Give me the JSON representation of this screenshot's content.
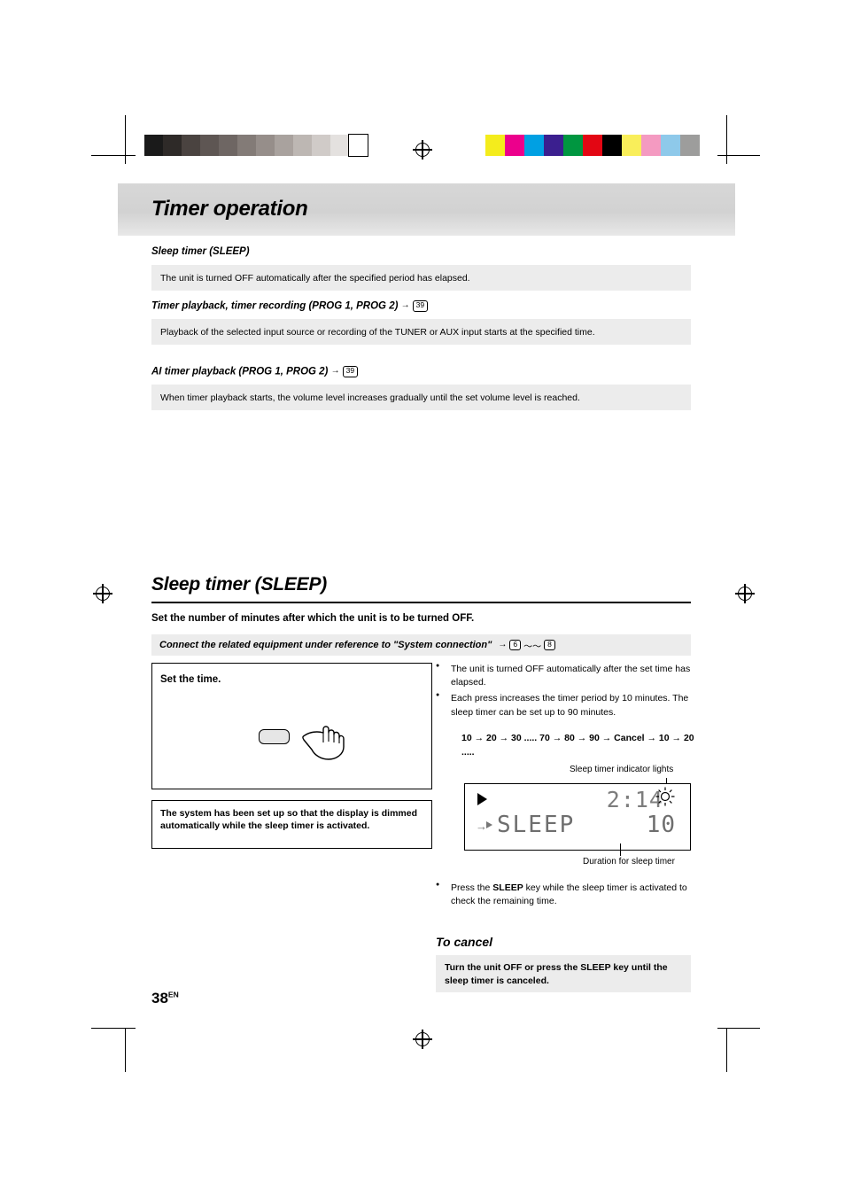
{
  "header": {
    "title": "Timer operation"
  },
  "sections": [
    {
      "heading": "Sleep timer (SLEEP)",
      "body": "The unit is turned OFF automatically after the specified period has elapsed.",
      "page_ref": null
    },
    {
      "heading": "Timer playback, timer recording (PROG 1, PROG 2)",
      "body": "Playback of the selected input source or recording of the TUNER or AUX input starts at the specified time.",
      "page_ref": "39"
    },
    {
      "heading": "AI timer playback (PROG 1, PROG 2)",
      "body": "When timer playback starts, the volume level increases gradually until the set volume level is reached.",
      "page_ref": "39"
    }
  ],
  "sleep_section": {
    "title": "Sleep timer (SLEEP)",
    "instruction": "Set the number of minutes after which the unit is to be turned OFF.",
    "connect_bar": {
      "text": "Connect the related equipment under reference to \"System connection\"",
      "ref_from": "6",
      "ref_to": "8",
      "ref_separator": "〜〜"
    },
    "set_box": {
      "label": "Set the time."
    },
    "dim_note": "The system has been set up so that the display is dimmed automatically while the sleep timer is activated.",
    "bullets": [
      "The unit is turned OFF automatically after the set time has elapsed.",
      "Each press increases the timer period by 10 minutes. The sleep timer can be set up to 90 minutes."
    ],
    "sequence": "10 → 20 → 30 ..... 70 → 80 → 90 → Cancel → 10 → 20 .....",
    "caption_top": "Sleep timer indicator lights",
    "caption_bottom": "Duration for sleep timer",
    "lcd": {
      "time": "2:14",
      "main_text": "SLEEP",
      "duration": "10"
    },
    "press_note_pre": "Press the ",
    "press_note_key": "SLEEP",
    "press_note_post": " key while the sleep timer is activated to check the remaining time.",
    "to_cancel_title": "To cancel",
    "cancel_text": "Turn the unit OFF or press the SLEEP key until the sleep timer is canceled."
  },
  "page_number": {
    "number": "38",
    "suffix": "EN"
  },
  "swatches_left": [
    "#1a1a1a",
    "#2e2a28",
    "#4a4340",
    "#5e5653",
    "#6e6663",
    "#837b77",
    "#968e8a",
    "#a9a29e",
    "#bdb7b3",
    "#d0cbc8",
    "#e4e1df",
    "#ffffff"
  ],
  "swatches_right": [
    "#f4ec1c",
    "#ec008c",
    "#00a0e3",
    "#3b1f8f",
    "#009640",
    "#e30613",
    "#000000",
    "#f9ee5a",
    "#f49ac1",
    "#8ec9ea",
    "#9d9d9c"
  ]
}
